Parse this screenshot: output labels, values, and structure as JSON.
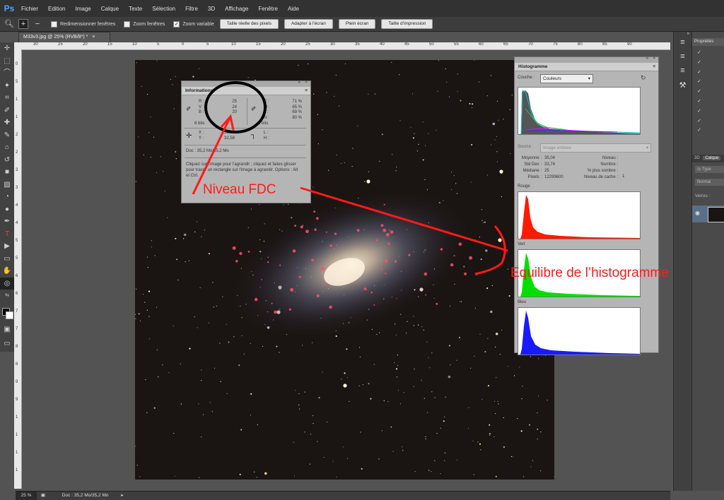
{
  "app": {
    "logo": "Ps"
  },
  "menu": [
    "Fichier",
    "Edition",
    "Image",
    "Calque",
    "Texte",
    "Sélection",
    "Filtre",
    "3D",
    "Affichage",
    "Fenêtre",
    "Aide"
  ],
  "options": {
    "resize_windows": "Redimensionner fenêtres",
    "zoom_windows": "Zoom fenêtres",
    "scrubby_zoom": "Zoom variable",
    "actual_pixels": "Taille réelle des pixels",
    "fit_screen": "Adapter à l'écran",
    "fill_screen": "Plein écran",
    "print_size": "Taille d'impression"
  },
  "document_tab": {
    "title": "M33v3.jpg @ 25% (RVB/8*) *",
    "close": "×"
  },
  "ruler": {
    "h_labels": [
      "30",
      "25",
      "20",
      "15",
      "10",
      "5",
      "0",
      "5",
      "10",
      "15",
      "20",
      "25",
      "30",
      "35",
      "40",
      "45",
      "50",
      "55",
      "60",
      "65",
      "70",
      "75",
      "80",
      "85",
      "90"
    ],
    "v_labels": [
      "0",
      "5",
      "1",
      "1",
      "2",
      "2",
      "3",
      "3",
      "4",
      "4",
      "5",
      "5",
      "6",
      "6",
      "7",
      "7",
      "8",
      "8",
      "9",
      "9",
      "1",
      "1",
      "1",
      "1"
    ]
  },
  "status": {
    "zoom": "25 %",
    "doc": "Doc : 35,2 Mo/35,2 Mo"
  },
  "info_panel": {
    "title": "Informations",
    "rgb_labels": [
      "R :",
      "V :",
      "B :"
    ],
    "rgb_values": [
      "25",
      "24",
      "20"
    ],
    "cmyk_labels": [
      "C :",
      "M :",
      "J :",
      "N :"
    ],
    "cmyk_values": [
      "71 %",
      "65 %",
      "69 %",
      "80 %"
    ],
    "bits_left": "8 bits",
    "bits_right": "8 bits",
    "x_label": "X :",
    "y_label": "Y :",
    "x_value": "59,97",
    "y_value": "32,58",
    "l_label": "L :",
    "h_label": "H :",
    "doc": "Doc : 35,2 Mo/35,2 Mo",
    "help": "Cliquez sur l'image pour l'agrandir ; cliquez et faites glisser pour tracer un rectangle sur l'image à agrandir. Options : Alt et Ctrl."
  },
  "histogram_panel": {
    "title": "Histogramme",
    "channel_label": "Couche :",
    "channel_value": "Couleurs",
    "source_label": "Source :",
    "source_value": "Image entière",
    "stats_left_labels": [
      "Moyenne :",
      "Std Dev :",
      "Médiane :",
      "Pixels :"
    ],
    "stats_left_values": [
      "35,04",
      "33,74",
      "25",
      "12299600"
    ],
    "stats_right_labels": [
      "Niveau :",
      "Nombre :",
      "% plus sombre :",
      "Niveau de cache :"
    ],
    "cache_level": "1",
    "red_label": "Rouge",
    "green_label": "Vert",
    "blue_label": "Bleu"
  },
  "annotations": {
    "niveau": "Niveau FDC",
    "equilibre": "Equilibre de l’histogramme"
  },
  "dock": {
    "properties": "Propriétés",
    "tab_3d": "3D",
    "tab_layers": "Calque",
    "kind": "Type",
    "mode": "Normal",
    "lock": "Verrou :"
  },
  "colors": {
    "annotation_red": "#ff1a1a",
    "ps_blue": "#4ea3ff"
  }
}
